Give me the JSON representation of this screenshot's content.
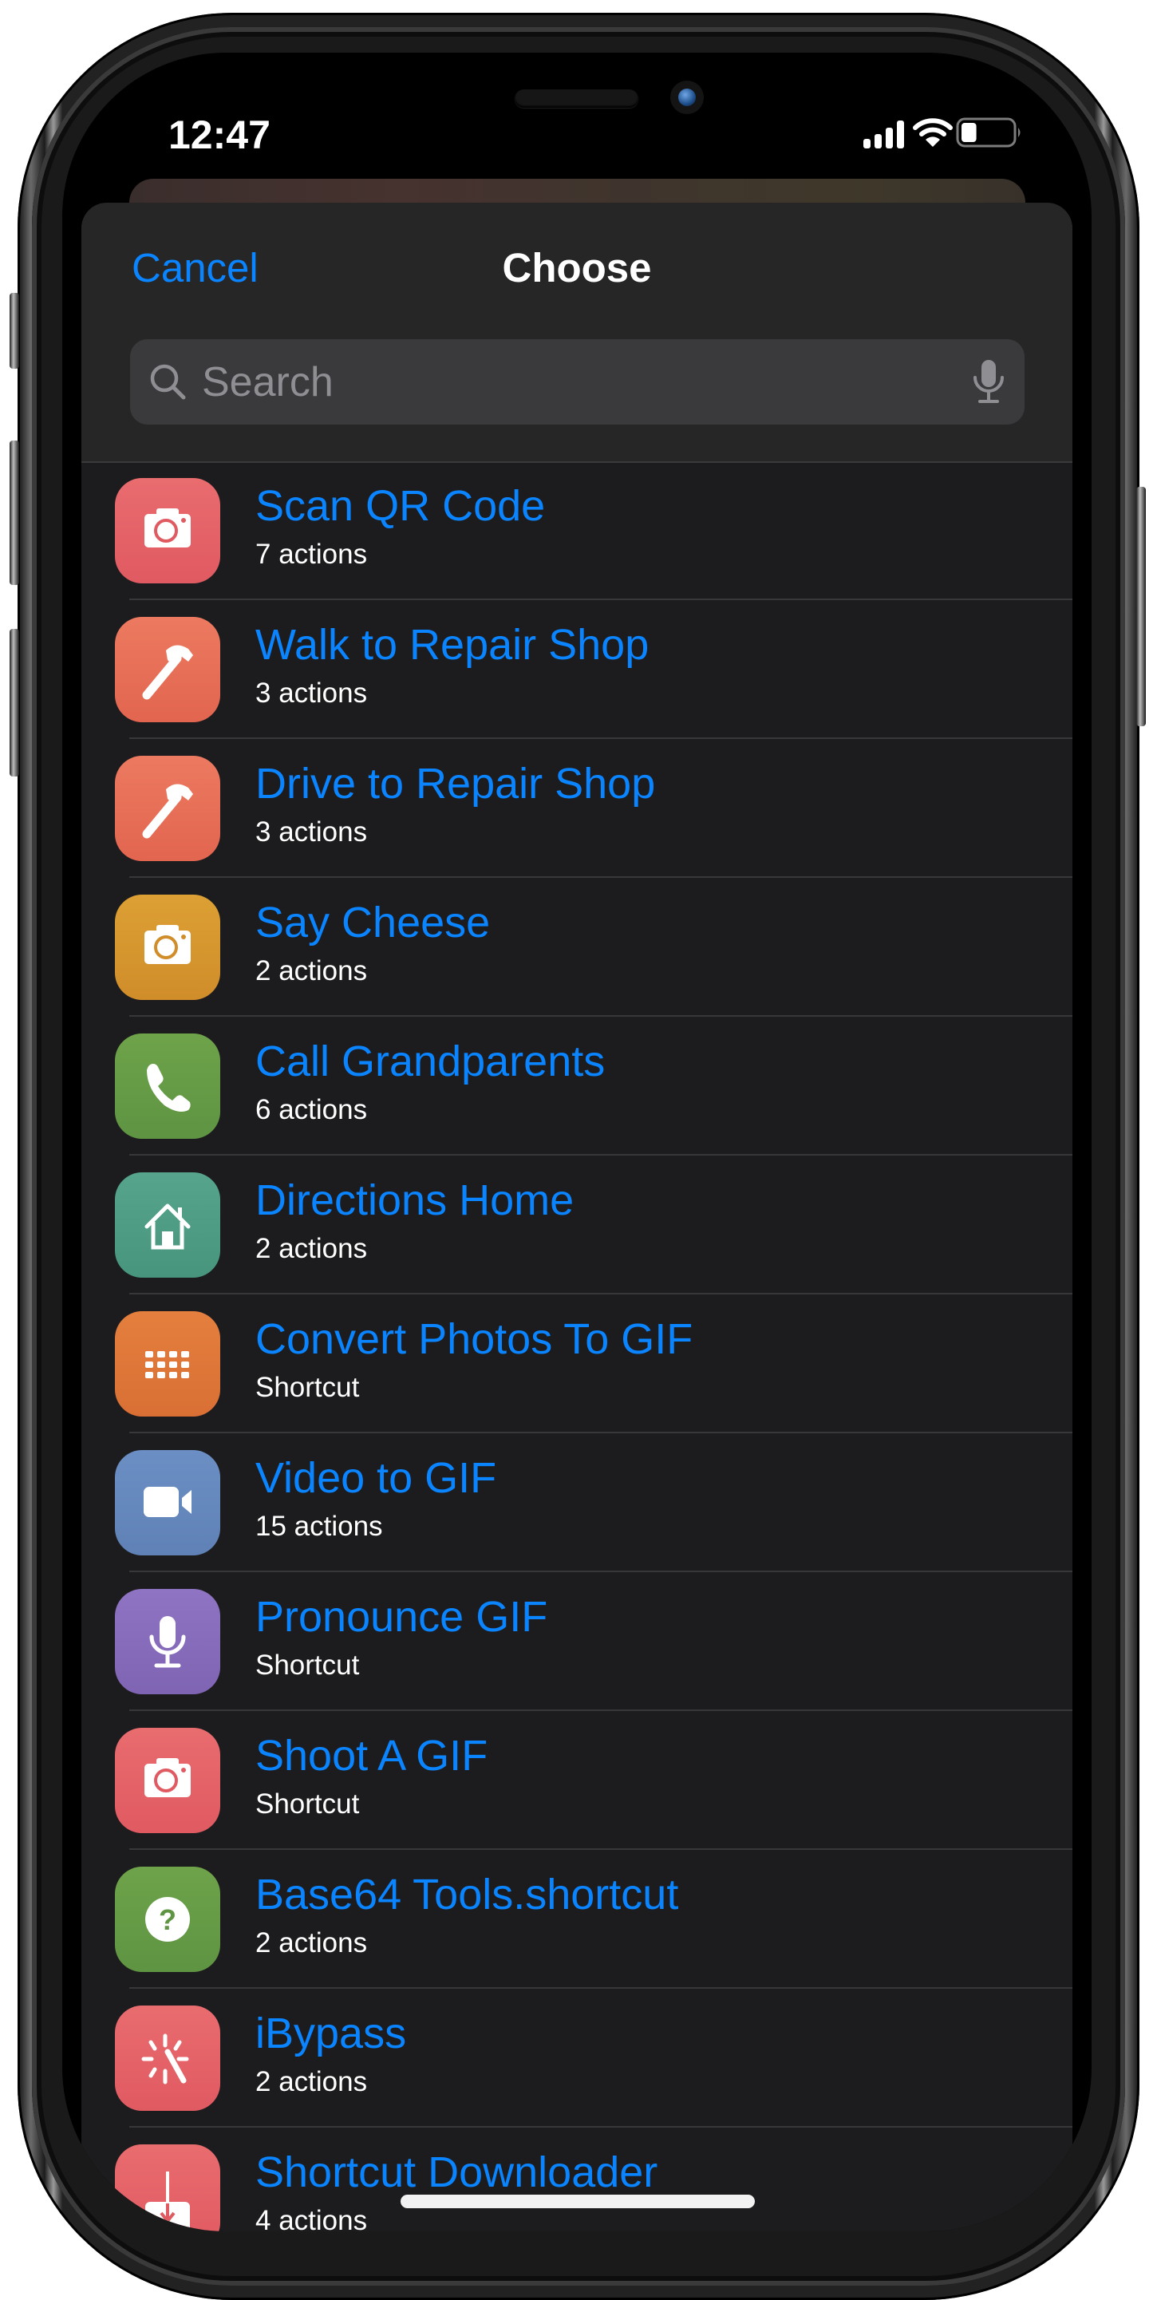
{
  "status_bar": {
    "time": "12:47",
    "battery_level": 0.3,
    "signal_bars": 4,
    "icons": [
      "cellular-signal-icon",
      "wifi-icon",
      "battery-icon"
    ]
  },
  "sheet": {
    "cancel_label": "Cancel",
    "title": "Choose",
    "search": {
      "placeholder": "Search",
      "value": ""
    }
  },
  "colors": {
    "accent": "#0a84ff",
    "sheet_header_bg": "#262627",
    "list_bg": "#1c1c1e",
    "search_bg": "#3a3a3c"
  },
  "shortcuts": [
    {
      "name": "Scan QR Code",
      "subtitle": "7 actions",
      "icon": "camera-icon",
      "color_top": "#e96c6f",
      "color_bottom": "#e05a61"
    },
    {
      "name": "Walk to Repair Shop",
      "subtitle": "3 actions",
      "icon": "hammer-icon",
      "color_top": "#ec7a60",
      "color_bottom": "#e2654f"
    },
    {
      "name": "Drive to Repair Shop",
      "subtitle": "3 actions",
      "icon": "hammer-icon",
      "color_top": "#ec7a60",
      "color_bottom": "#e2654f"
    },
    {
      "name": "Say Cheese",
      "subtitle": "2 actions",
      "icon": "camera-icon",
      "color_top": "#dca034",
      "color_bottom": "#d08d2a"
    },
    {
      "name": "Call Grandparents",
      "subtitle": "6 actions",
      "icon": "phone-icon",
      "color_top": "#6ea34a",
      "color_bottom": "#5e9442"
    },
    {
      "name": "Directions Home",
      "subtitle": "2 actions",
      "icon": "house-icon",
      "color_top": "#56a48c",
      "color_bottom": "#47957c"
    },
    {
      "name": "Convert Photos To GIF",
      "subtitle": "Shortcut",
      "icon": "grid-icon",
      "color_top": "#e47f3e",
      "color_bottom": "#d96f34"
    },
    {
      "name": "Video to GIF",
      "subtitle": "15 actions",
      "icon": "video-camera-icon",
      "color_top": "#6b8fc4",
      "color_bottom": "#5f81b6"
    },
    {
      "name": "Pronounce GIF",
      "subtitle": "Shortcut",
      "icon": "microphone-icon",
      "color_top": "#8e74c2",
      "color_bottom": "#7f64b4"
    },
    {
      "name": "Shoot A GIF",
      "subtitle": "Shortcut",
      "icon": "camera-icon",
      "color_top": "#e96c6f",
      "color_bottom": "#e05a61"
    },
    {
      "name": "Base64 Tools.shortcut",
      "subtitle": "2 actions",
      "icon": "question-icon",
      "color_top": "#6ea34a",
      "color_bottom": "#5e9442"
    },
    {
      "name": "iBypass",
      "subtitle": "2 actions",
      "icon": "magic-wand-icon",
      "color_top": "#e96c6f",
      "color_bottom": "#e05a61"
    },
    {
      "name": "Shortcut Downloader",
      "subtitle": "4 actions",
      "icon": "download-icon",
      "color_top": "#e96c6f",
      "color_bottom": "#e05a61"
    }
  ]
}
